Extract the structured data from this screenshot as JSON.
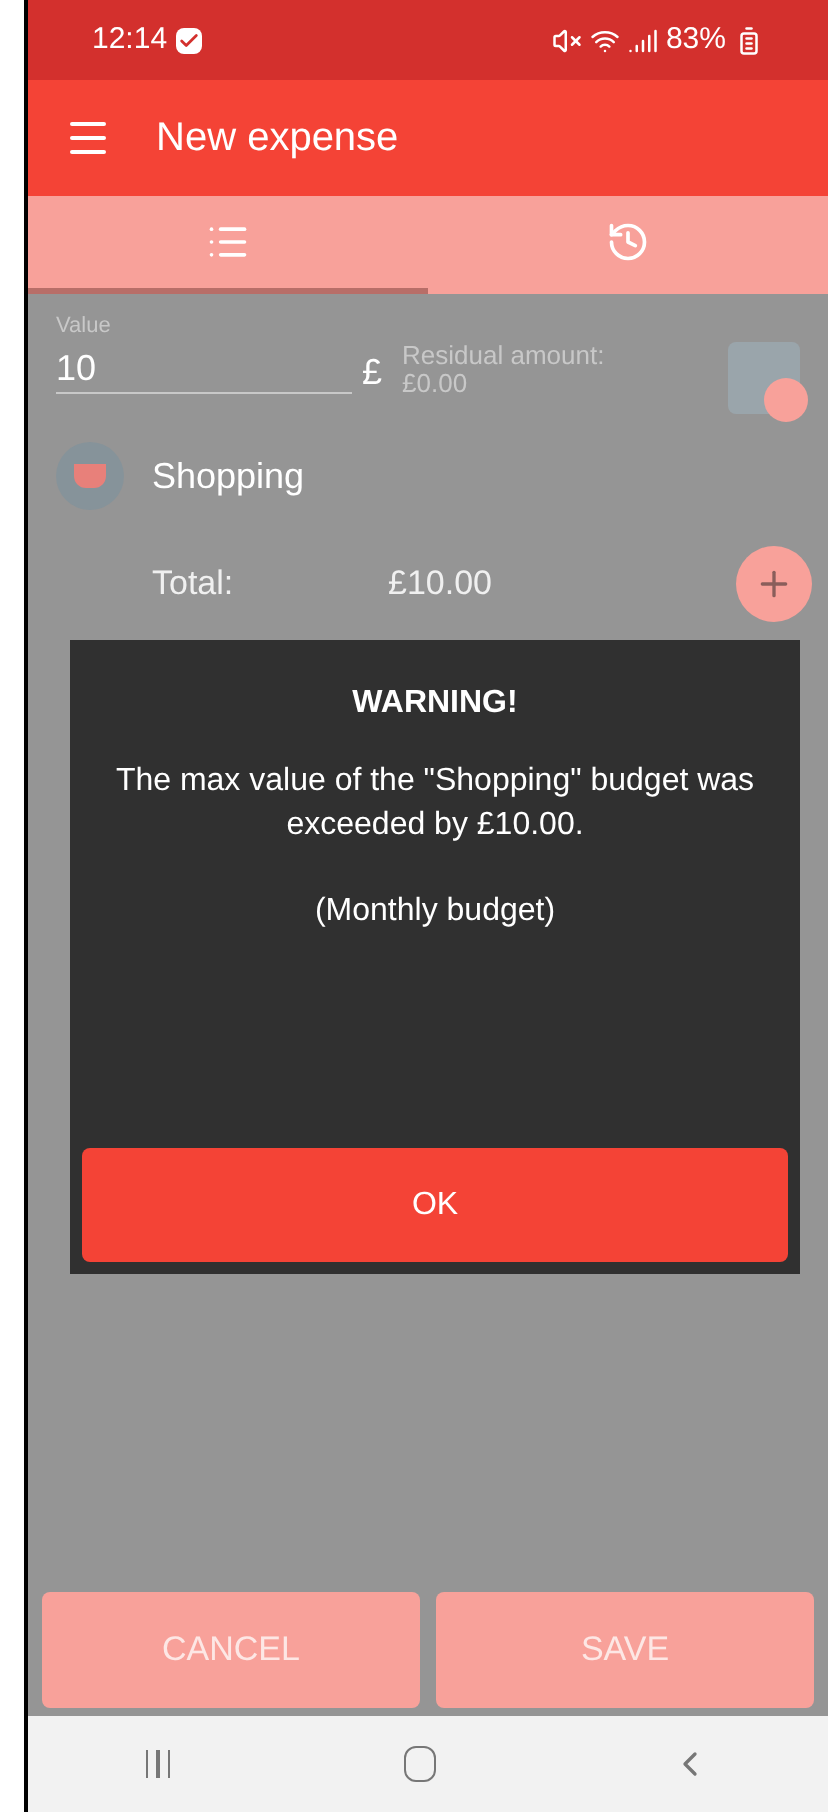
{
  "status_bar": {
    "time": "12:14",
    "battery": "83%"
  },
  "toolbar": {
    "title": "New expense"
  },
  "tabs": [
    {
      "kind": "list",
      "selected": true
    },
    {
      "kind": "history",
      "selected": false
    }
  ],
  "form": {
    "value_label": "Value",
    "value": "10",
    "currency": "£",
    "residual_label": "Residual amount:",
    "residual_value": "£0.00",
    "category": "Shopping",
    "total_label": "Total:",
    "total_value": "£10.00"
  },
  "dialog": {
    "title": "WARNING!",
    "message": "The max value of the \"Shopping\" budget was exceeded by £10.00.",
    "note": "(Monthly budget)",
    "button": "OK"
  },
  "buttons": [
    "CANCEL",
    "SAVE"
  ]
}
